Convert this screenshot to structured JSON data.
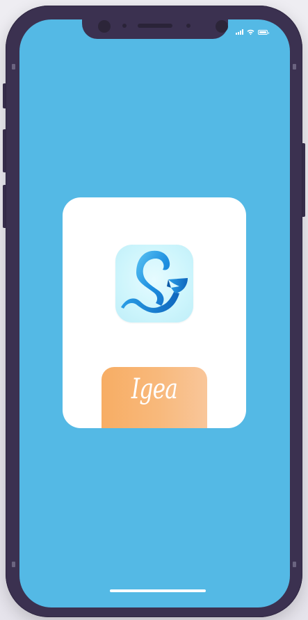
{
  "app": {
    "brand_name": "Igea",
    "icon_name": "igea-logo-icon"
  },
  "status_bar": {
    "icons": [
      "signal-icon",
      "wifi-icon",
      "battery-icon"
    ]
  },
  "colors": {
    "screen_background": "#54b9e5",
    "phone_frame": "#3b3150",
    "card": "#ffffff",
    "brand_tab_start": "#f7ad64",
    "brand_tab_end": "#f9c69a",
    "logo_blue": "#1e8fe0"
  }
}
